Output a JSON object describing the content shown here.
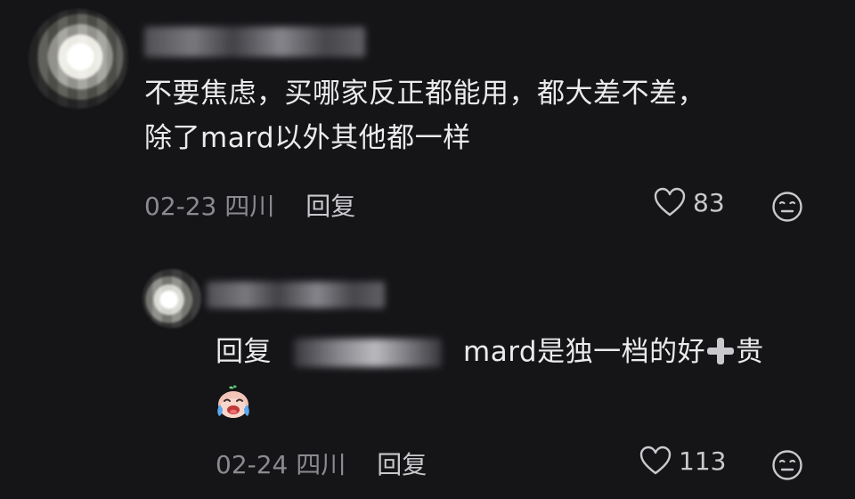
{
  "comment": {
    "text_line1": "不要焦虑，买哪家反正都能用，都大差不差，",
    "text_line2": "除了mard以外其他都一样",
    "date": "02-23",
    "location": "四川",
    "reply_label": "回复",
    "likes": "83",
    "icons": {
      "like": "heart-outline-icon",
      "dislike": "meh-face-icon"
    }
  },
  "reply": {
    "prefix": "回复",
    "text_before_plus": "mard是独一档的好",
    "text_after_plus": "贵",
    "emoji": "crying-laughing-emoji",
    "date": "02-24",
    "location": "四川",
    "reply_label": "回复",
    "likes": "113",
    "icons": {
      "plus": "heavy-plus-icon",
      "like": "heart-outline-icon",
      "dislike": "meh-face-icon"
    }
  },
  "colors": {
    "background": "#151518",
    "text": "#ebebed",
    "meta": "#8a8a90",
    "action": "#c9c9cd"
  }
}
